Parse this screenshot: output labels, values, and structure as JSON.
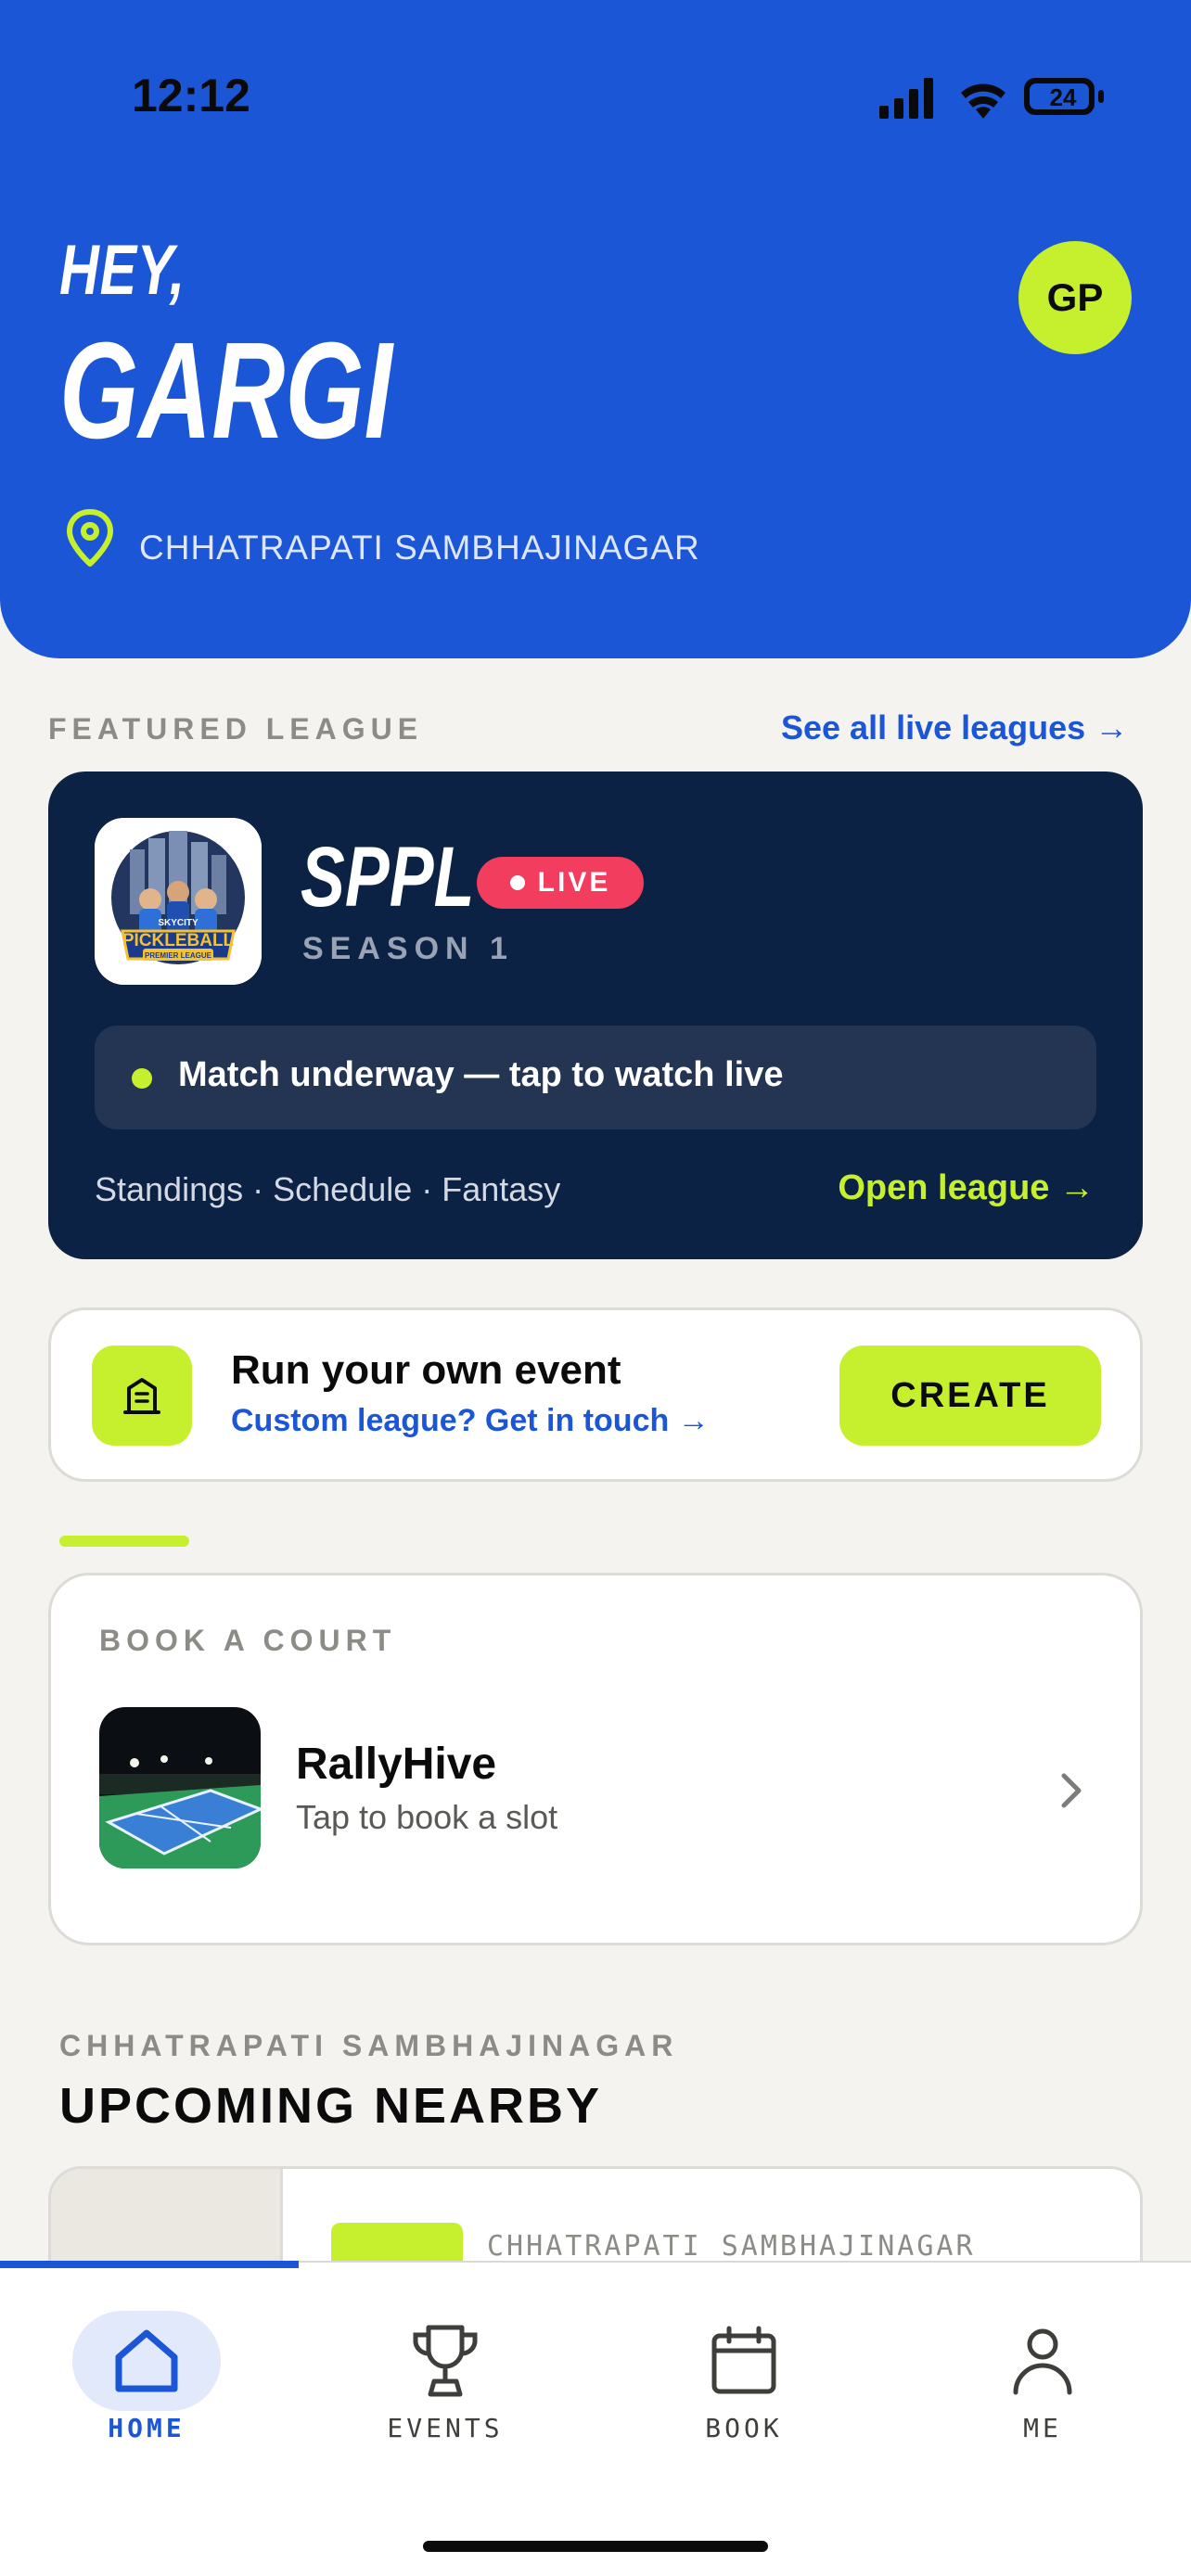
{
  "status_bar": {
    "time": "12:12",
    "battery": "24"
  },
  "header": {
    "greeting": "HEY,",
    "user_name": "GARGI",
    "avatar_initials": "GP",
    "location": "CHHATRAPATI SAMBHAJINAGAR"
  },
  "featured": {
    "section_label": "FEATURED LEAGUE",
    "see_all_label": "See all live leagues →",
    "league_name": "SPPL",
    "live_badge": "LIVE",
    "season": "SEASON 1",
    "logo_text_top": "SKYCITY",
    "logo_text_main": "PICKLEBALL",
    "logo_text_bottom": "PREMIER LEAGUE",
    "match_status": "Match underway — tap to watch live",
    "links": "Standings · Schedule · Fantasy",
    "open_label": "Open league →"
  },
  "create_event": {
    "title": "Run your own event",
    "subtitle": "Custom league? Get in touch →",
    "button_label": "CREATE"
  },
  "book_court": {
    "section_label": "BOOK A COURT",
    "venue_name": "RallyHive",
    "venue_sub": "Tap to book a slot"
  },
  "upcoming": {
    "city": "CHHATRAPATI SAMBHAJINAGAR",
    "title": "UPCOMING NEARBY",
    "card_city": "CHHATRAPATI SAMBHAJINAGAR"
  },
  "tabs": [
    {
      "label": "HOME",
      "icon": "home-icon",
      "active": true
    },
    {
      "label": "EVENTS",
      "icon": "trophy-icon",
      "active": false
    },
    {
      "label": "BOOK",
      "icon": "calendar-icon",
      "active": false
    },
    {
      "label": "ME",
      "icon": "person-icon",
      "active": false
    }
  ],
  "colors": {
    "brand_blue": "#1a56d6",
    "lime": "#c6f02d",
    "navy": "#0c2244",
    "live_red": "#f23d5e"
  }
}
